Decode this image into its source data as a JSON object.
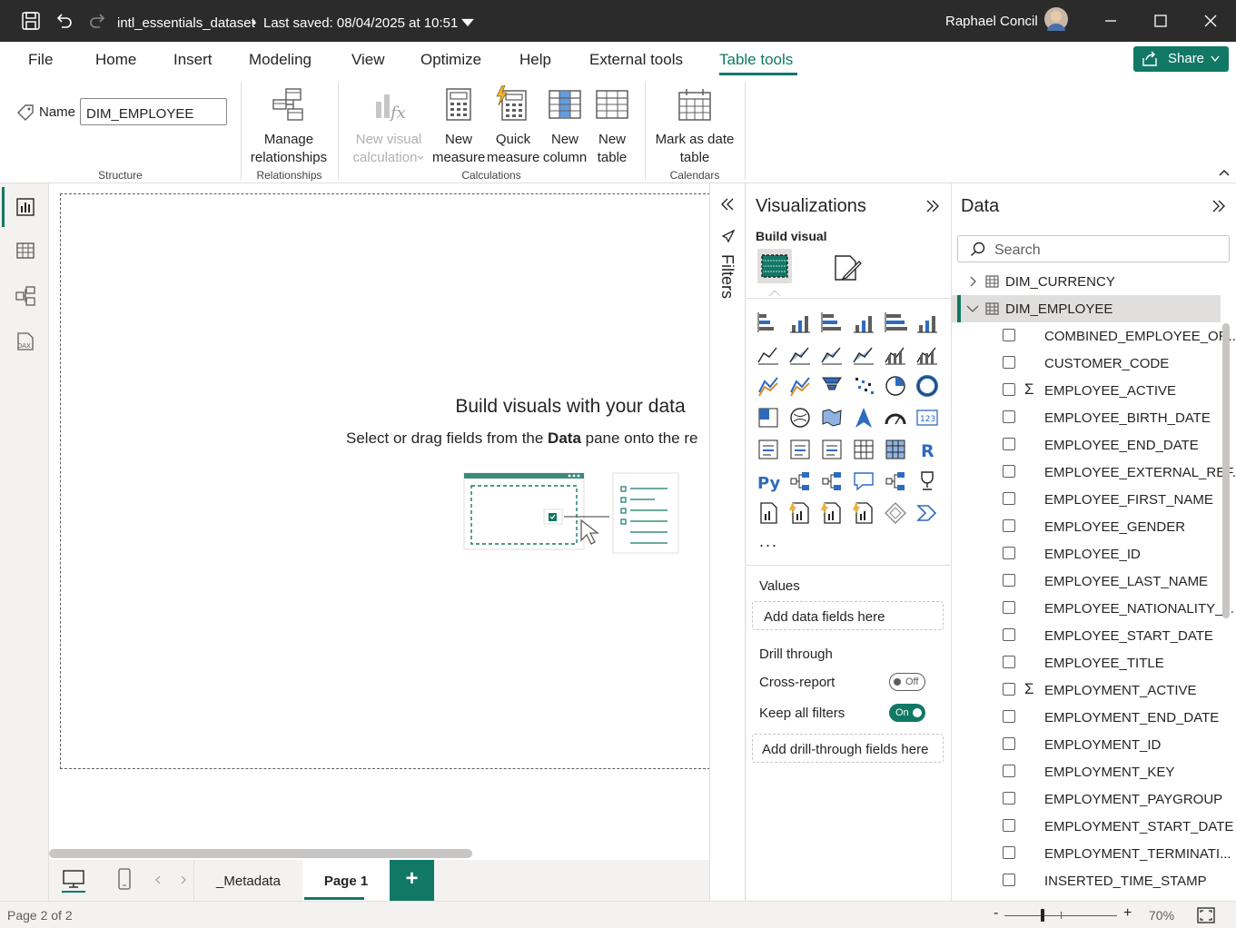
{
  "titlebar": {
    "file_name": "intl_essentials_dataset",
    "separator": "•",
    "saved_status": "Last saved: 08/04/2025 at 10:51",
    "user_name": "Raphael Concil"
  },
  "ribbon_tabs": [
    "File",
    "Home",
    "Insert",
    "Modeling",
    "View",
    "Optimize",
    "Help",
    "External tools",
    "Table tools"
  ],
  "active_tab": "Table tools",
  "share_label": "Share",
  "ribbon": {
    "name_label": "Name",
    "name_value": "DIM_EMPLOYEE",
    "structure_label": "Structure",
    "manage_rel_line1": "Manage",
    "manage_rel_line2": "relationships",
    "relationships_label": "Relationships",
    "new_visual_calc_line1": "New visual",
    "new_visual_calc_line2": "calculation",
    "new_measure_line1": "New",
    "new_measure_line2": "measure",
    "quick_measure_line1": "Quick",
    "quick_measure_line2": "measure",
    "new_column_line1": "New",
    "new_column_line2": "column",
    "new_table_line1": "New",
    "new_table_line2": "table",
    "calculations_label": "Calculations",
    "mark_date_line1": "Mark as date",
    "mark_date_line2": "table",
    "calendars_label": "Calendars"
  },
  "canvas": {
    "title": "Build visuals with your data",
    "subtitle_prefix": "Select or drag fields from the ",
    "subtitle_bold": "Data",
    "subtitle_suffix": " pane onto the re"
  },
  "page_tabs": [
    "_Metadata",
    "Page 1"
  ],
  "active_page": "Page 1",
  "add_page_label": "+",
  "filters_label": "Filters",
  "visualizations": {
    "title": "Visualizations",
    "build_visual_label": "Build visual",
    "more_label": "...",
    "values_label": "Values",
    "values_placeholder": "Add data fields here",
    "drill_through_label": "Drill through",
    "cross_report_label": "Cross-report",
    "cross_report_state": "Off",
    "keep_filters_label": "Keep all filters",
    "keep_filters_state": "On",
    "drill_placeholder": "Add drill-through fields here"
  },
  "data_pane": {
    "title": "Data",
    "search_placeholder": "Search",
    "tables": [
      {
        "name": "DIM_CURRENCY",
        "expanded": false
      },
      {
        "name": "DIM_EMPLOYEE",
        "expanded": true
      }
    ],
    "fields": [
      {
        "name": "COMBINED_EMPLOYEE_OR...",
        "sigma": false
      },
      {
        "name": "CUSTOMER_CODE",
        "sigma": false
      },
      {
        "name": "EMPLOYEE_ACTIVE",
        "sigma": true
      },
      {
        "name": "EMPLOYEE_BIRTH_DATE",
        "sigma": false
      },
      {
        "name": "EMPLOYEE_END_DATE",
        "sigma": false
      },
      {
        "name": "EMPLOYEE_EXTERNAL_REF...",
        "sigma": false
      },
      {
        "name": "EMPLOYEE_FIRST_NAME",
        "sigma": false
      },
      {
        "name": "EMPLOYEE_GENDER",
        "sigma": false
      },
      {
        "name": "EMPLOYEE_ID",
        "sigma": false
      },
      {
        "name": "EMPLOYEE_LAST_NAME",
        "sigma": false
      },
      {
        "name": "EMPLOYEE_NATIONALITY_...",
        "sigma": false
      },
      {
        "name": "EMPLOYEE_START_DATE",
        "sigma": false
      },
      {
        "name": "EMPLOYEE_TITLE",
        "sigma": false
      },
      {
        "name": "EMPLOYMENT_ACTIVE",
        "sigma": true
      },
      {
        "name": "EMPLOYMENT_END_DATE",
        "sigma": false
      },
      {
        "name": "EMPLOYMENT_ID",
        "sigma": false
      },
      {
        "name": "EMPLOYMENT_KEY",
        "sigma": false
      },
      {
        "name": "EMPLOYMENT_PAYGROUP",
        "sigma": false
      },
      {
        "name": "EMPLOYMENT_START_DATE",
        "sigma": false
      },
      {
        "name": "EMPLOYMENT_TERMINATI...",
        "sigma": false
      },
      {
        "name": "INSERTED_TIME_STAMP",
        "sigma": false
      }
    ]
  },
  "status": {
    "page_info": "Page 2 of 2",
    "zoom_minus": "-",
    "zoom_plus": "+",
    "zoom": "70%"
  },
  "colors": {
    "accent": "#117865",
    "titlebar": "#2b2b2b"
  }
}
